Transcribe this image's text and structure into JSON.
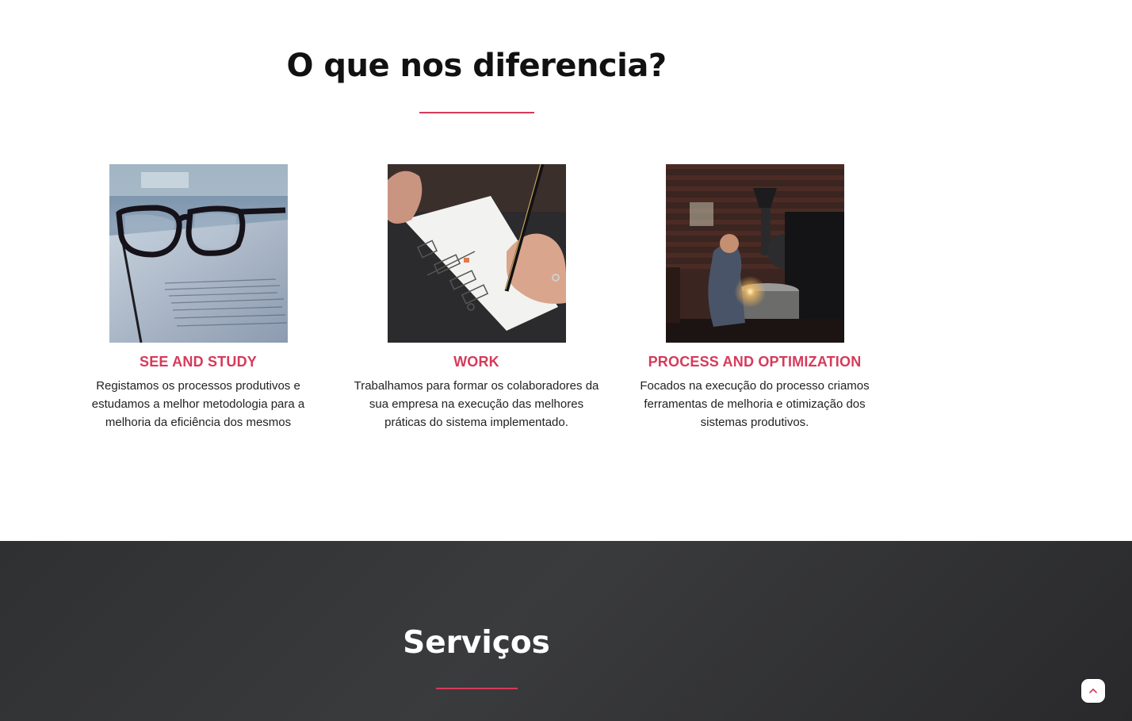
{
  "diff": {
    "title": "O que nos diferencia?",
    "cards": [
      {
        "title": "SEE AND STUDY",
        "text": "Registamos os processos produtivos e estudamos a melhor metodologia para a melhoria da eficiência dos mesmos",
        "image_icon": "glasses-photo"
      },
      {
        "title": "WORK",
        "text": "Trabalhamos para formar os colaboradores da sua empresa na execução das melhores práticas do sistema implementado.",
        "image_icon": "sketching-photo"
      },
      {
        "title": "PROCESS AND OPTIMIZATION",
        "text": "Focados na execução do processo criamos ferramentas de melhoria e otimização dos sistemas produtivos.",
        "image_icon": "coffee-roaster-photo"
      }
    ]
  },
  "services": {
    "title": "Serviços"
  },
  "colors": {
    "accent": "#d63a5a",
    "dark_bg": "#2f3032"
  },
  "scroll_top": {
    "icon": "chevron-up-icon"
  }
}
